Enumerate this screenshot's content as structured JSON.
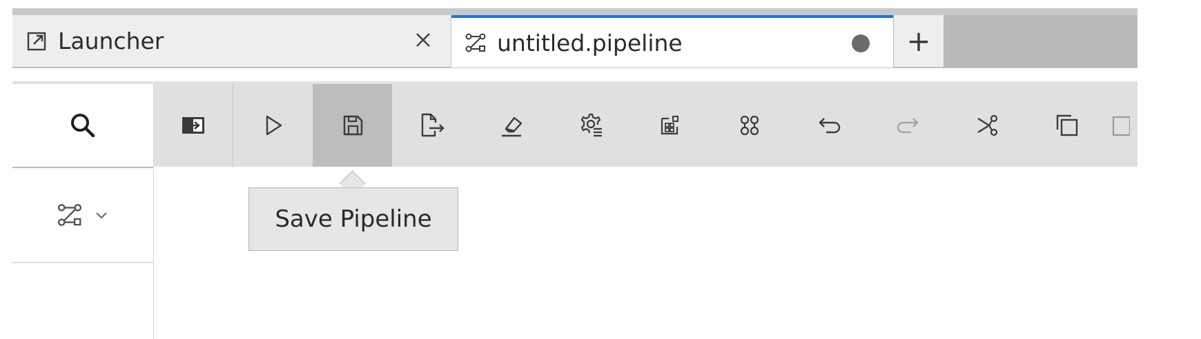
{
  "tabs": {
    "launcher": {
      "label": "Launcher",
      "icon": "launcher-icon",
      "close_icon": "close-icon"
    },
    "pipeline": {
      "label": "untitled.pipeline",
      "icon": "pipeline-icon",
      "dirty_indicator": "unsaved-dot"
    },
    "add_label": "+"
  },
  "left_panel": {
    "search_icon": "search-icon",
    "palette_icon": "pipeline-icon",
    "palette_dropdown_icon": "chevron-down-icon"
  },
  "toolbar": {
    "items": [
      {
        "name": "open-panel-button",
        "icon": "panel-open-icon"
      },
      {
        "name": "run-pipeline-button",
        "icon": "play-icon"
      },
      {
        "name": "save-pipeline-button",
        "icon": "save-icon",
        "active": true
      },
      {
        "name": "export-pipeline-button",
        "icon": "export-icon"
      },
      {
        "name": "clear-pipeline-button",
        "icon": "eraser-icon"
      },
      {
        "name": "runtime-settings-button",
        "icon": "settings-list-icon"
      },
      {
        "name": "runtime-images-button",
        "icon": "images-icon"
      },
      {
        "name": "components-button",
        "icon": "components-icon"
      },
      {
        "name": "undo-button",
        "icon": "undo-icon"
      },
      {
        "name": "redo-button",
        "icon": "redo-icon",
        "disabled": true
      },
      {
        "name": "cut-button",
        "icon": "cut-icon"
      },
      {
        "name": "copy-button",
        "icon": "copy-icon"
      },
      {
        "name": "paste-button",
        "icon": "paste-icon"
      }
    ]
  },
  "tooltip": {
    "text": "Save Pipeline"
  },
  "colors": {
    "active_tab_accent": "#1a73e8",
    "toolbar_bg": "#e0e0e0",
    "active_button_bg": "#bdbdbd",
    "tooltip_bg": "#e6e6e6"
  }
}
